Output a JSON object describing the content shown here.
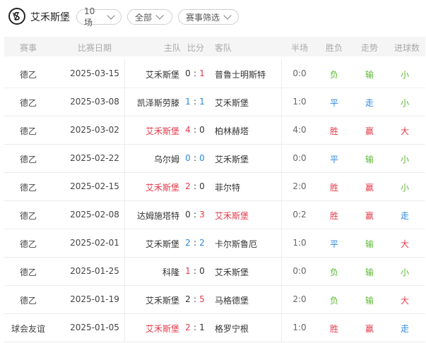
{
  "header": {
    "team_name": "艾禾斯堡",
    "filters": {
      "matches": "10场",
      "scope": "全部",
      "competition": "赛事筛选"
    }
  },
  "columns": {
    "league": "赛事",
    "date": "比赛日期",
    "home": "主队",
    "score": "比分",
    "away": "客队",
    "half": "半场",
    "result": "胜负",
    "trend": "走势",
    "ou": "进球数"
  },
  "colors": {
    "win": "#e23a4a",
    "draw": "#2b88e0",
    "lose": "#5cb833",
    "highlight_team": "#e23a4a"
  },
  "matches": [
    {
      "league": "德乙",
      "date": "2025-03-15",
      "home": "艾禾斯堡",
      "home_score": "0",
      "away_score": "1",
      "away": "普鲁士明斯特",
      "half": "0:0",
      "result": "负",
      "trend": "输",
      "ou": "小"
    },
    {
      "league": "德乙",
      "date": "2025-03-08",
      "home": "凯泽斯劳滕",
      "home_score": "1",
      "away_score": "1",
      "away": "艾禾斯堡",
      "half": "1:0",
      "result": "平",
      "trend": "走",
      "ou": "小"
    },
    {
      "league": "德乙",
      "date": "2025-03-02",
      "home": "艾禾斯堡",
      "home_score": "4",
      "away_score": "0",
      "away": "柏林赫塔",
      "half": "4:0",
      "result": "胜",
      "trend": "赢",
      "ou": "大"
    },
    {
      "league": "德乙",
      "date": "2025-02-22",
      "home": "乌尔姆",
      "home_score": "0",
      "away_score": "0",
      "away": "艾禾斯堡",
      "half": "0:0",
      "result": "平",
      "trend": "输",
      "ou": "小"
    },
    {
      "league": "德乙",
      "date": "2025-02-15",
      "home": "艾禾斯堡",
      "home_score": "2",
      "away_score": "0",
      "away": "菲尔特",
      "half": "2:0",
      "result": "胜",
      "trend": "赢",
      "ou": "小"
    },
    {
      "league": "德乙",
      "date": "2025-02-08",
      "home": "达姆施塔特",
      "home_score": "0",
      "away_score": "3",
      "away": "艾禾斯堡",
      "half": "0:2",
      "result": "胜",
      "trend": "赢",
      "ou": "走"
    },
    {
      "league": "德乙",
      "date": "2025-02-01",
      "home": "艾禾斯堡",
      "home_score": "2",
      "away_score": "2",
      "away": "卡尔斯鲁厄",
      "half": "1:0",
      "result": "平",
      "trend": "输",
      "ou": "大"
    },
    {
      "league": "德乙",
      "date": "2025-01-25",
      "home": "科隆",
      "home_score": "1",
      "away_score": "0",
      "away": "艾禾斯堡",
      "half": "0:0",
      "result": "负",
      "trend": "输",
      "ou": "小"
    },
    {
      "league": "德乙",
      "date": "2025-01-19",
      "home": "艾禾斯堡",
      "home_score": "2",
      "away_score": "5",
      "away": "马格德堡",
      "half": "2:0",
      "result": "负",
      "trend": "输",
      "ou": "大"
    },
    {
      "league": "球会友谊",
      "date": "2025-01-05",
      "home": "艾禾斯堡",
      "home_score": "2",
      "away_score": "1",
      "away": "格罗宁根",
      "half": "1:0",
      "result": "胜",
      "trend": "赢",
      "ou": "走"
    }
  ]
}
